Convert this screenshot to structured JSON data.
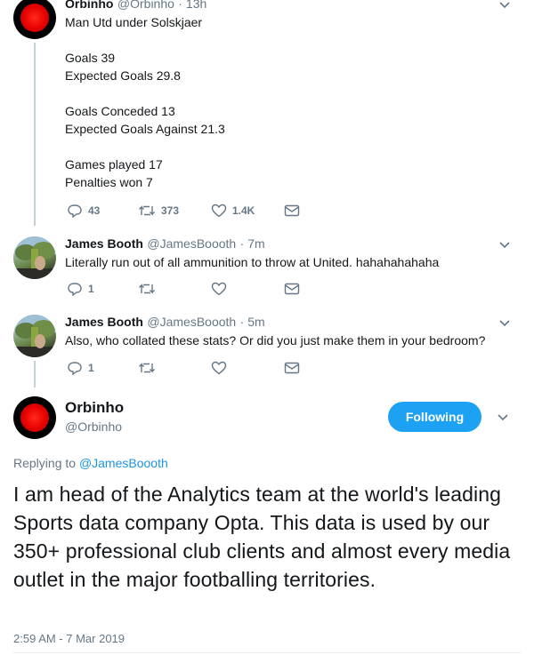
{
  "tweets": [
    {
      "name": "Orbinho",
      "handle": "@Orbinho",
      "time": "· 13h",
      "lines": [
        "Man Utd under Solskjaer",
        "",
        "Goals 39",
        "Expected Goals 29.8",
        "",
        "Goals Conceded 13",
        "Expected Goals Against 21.3",
        "",
        "Games played 17",
        "Penalties won 7"
      ],
      "replies": "43",
      "retweets": "373",
      "likes": "1.4K"
    },
    {
      "name": "James Booth",
      "handle": "@JamesBoooth",
      "time": "· 7m",
      "text": "Literally run out of all ammunition to throw at United. hahahahahaha",
      "replies": "1",
      "retweets": "",
      "likes": ""
    },
    {
      "name": "James Booth",
      "handle": "@JamesBoooth",
      "time": "· 5m",
      "text": "Also, who collated these stats? Or did you just make them in your bedroom?",
      "replies": "1",
      "retweets": "",
      "likes": ""
    }
  ],
  "main": {
    "name": "Orbinho",
    "handle": "@Orbinho",
    "follow_label": "Following",
    "replying_prefix": "Replying to",
    "replying_to": "@JamesBoooth",
    "text": "I am head of the Analytics team at the world's leading Sports data company Opta. This data is used by our 350+ professional club clients and almost every media outlet in the major footballing territories.",
    "timestamp": "2:59 AM - 7 Mar 2019"
  },
  "colors": {
    "accent": "#1da1f2",
    "link": "#1b95e0",
    "muted": "#657786"
  }
}
